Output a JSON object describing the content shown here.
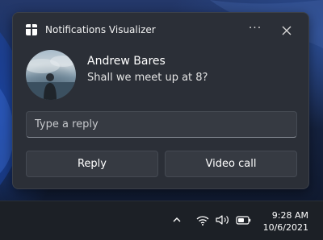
{
  "notification": {
    "app_name": "Notifications Visualizer",
    "more_label": "···",
    "sender": "Andrew Bares",
    "message": "Shall we meet up at 8?",
    "reply_placeholder": "Type a reply",
    "actions": [
      {
        "label": "Reply"
      },
      {
        "label": "Video call"
      }
    ]
  },
  "taskbar": {
    "tray_icons": [
      "chevron-up-icon",
      "wifi-icon",
      "volume-icon",
      "battery-icon"
    ],
    "clock": {
      "time": "9:28 AM",
      "date": "10/6/2021"
    }
  }
}
